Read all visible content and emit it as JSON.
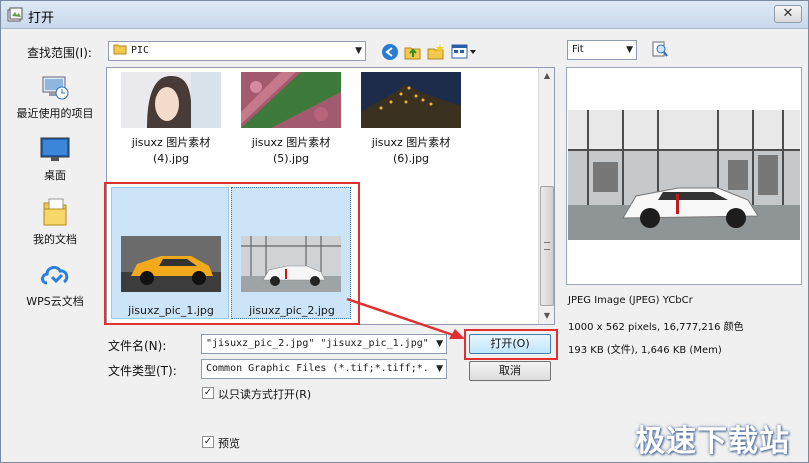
{
  "window": {
    "title": "打开",
    "close": "✕"
  },
  "lookin": {
    "label": "查找范围(I):",
    "value": "PIC"
  },
  "places": [
    {
      "label": "最近使用的项目",
      "icon": "recent-items-icon"
    },
    {
      "label": "桌面",
      "icon": "desktop-icon"
    },
    {
      "label": "我的文档",
      "icon": "documents-icon"
    },
    {
      "label": "WPS云文档",
      "icon": "cloud-icon"
    }
  ],
  "files": [
    {
      "line1": "jisuxz 图片素材",
      "line2": "(4).jpg",
      "pic": "portrait-thumbnail"
    },
    {
      "line1": "jisuxz 图片素材",
      "line2": "(5).jpg",
      "pic": "aerial-trees-thumbnail"
    },
    {
      "line1": "jisuxz 图片素材",
      "line2": "(6).jpg",
      "pic": "night-town-thumbnail"
    },
    {
      "line1": "jisuxz_pic_1.jpg",
      "pic": "yellow-suv-thumbnail",
      "selected": true
    },
    {
      "line1": "jisuxz_pic_2.jpg",
      "pic": "white-car-showroom-thumbnail",
      "selected": true,
      "focused": true
    }
  ],
  "filename": {
    "label": "文件名(N):",
    "value": "\"jisuxz_pic_2.jpg\" \"jisuxz_pic_1.jpg\""
  },
  "filetype": {
    "label": "文件类型(T):",
    "value": "Common Graphic Files (*.tif;*.tiff;*."
  },
  "readonly": {
    "label": "以只读方式打开(R)",
    "checked": true
  },
  "preview_check": {
    "label": "预览",
    "checked": true
  },
  "buttons": {
    "open": "打开(O)",
    "cancel": "取消"
  },
  "preview": {
    "zoom": "Fit",
    "info_lines": [
      "JPEG Image (JPEG) YCbCr",
      "1000 x 562 pixels, 16,777,216 颜色",
      "193 KB (文件), 1,646 KB (Mem)"
    ]
  },
  "watermark": "极速下载站",
  "colors": {
    "highlight": "#e03030",
    "selection": "#cce4f7"
  }
}
